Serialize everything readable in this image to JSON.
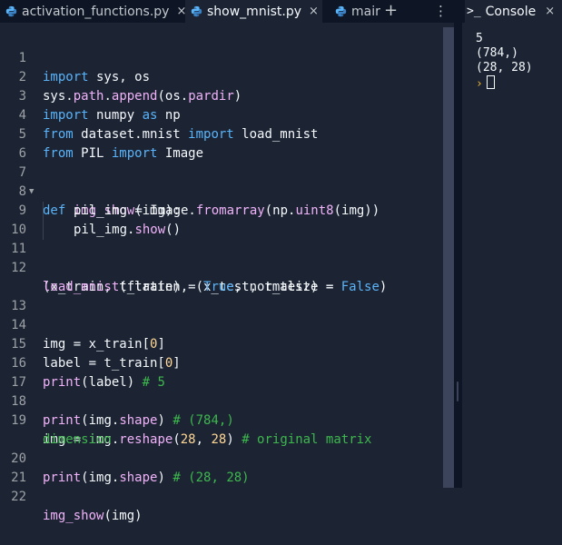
{
  "tabs": [
    {
      "label": "activation_functions.py",
      "active": false
    },
    {
      "label": "show_mnist.py",
      "active": true
    },
    {
      "label": "mair",
      "active": false
    }
  ],
  "tab_close_glyph": "×",
  "tab_add_glyph": "+",
  "tab_menu_glyph": "⋮",
  "code_lines": [
    {
      "n": "1"
    },
    {
      "n": "2"
    },
    {
      "n": "3"
    },
    {
      "n": "4"
    },
    {
      "n": "5"
    },
    {
      "n": "6"
    },
    {
      "n": "7"
    },
    {
      "n": "8"
    },
    {
      "n": "9"
    },
    {
      "n": "10"
    },
    {
      "n": "11"
    },
    {
      "n": "12"
    },
    {
      "n": "13"
    },
    {
      "n": "14"
    },
    {
      "n": "15"
    },
    {
      "n": "16"
    },
    {
      "n": "17"
    },
    {
      "n": "18"
    },
    {
      "n": "19"
    },
    {
      "n": "20"
    },
    {
      "n": "21"
    },
    {
      "n": "22"
    }
  ],
  "code": {
    "l1": [
      "import",
      " sys, os"
    ],
    "l2": [
      "sys",
      ".",
      "path",
      ".",
      "append",
      "(os.",
      "pardir",
      ")"
    ],
    "l3": [
      "import",
      " numpy ",
      "as",
      " np"
    ],
    "l4": [
      "from",
      " dataset.mnist ",
      "import",
      " load_mnist"
    ],
    "l5": [
      "from",
      " PIL ",
      "import",
      " Image"
    ],
    "l7": [
      "def",
      " ",
      "img_show",
      "(img):"
    ],
    "l8": [
      "pil_img = Image.",
      "fromarray",
      "(np.",
      "uint8",
      "(img))"
    ],
    "l9": [
      "pil_img.",
      "show",
      "()"
    ],
    "l12a": [
      "(x_train, t_train), (x_test, t_test) ="
    ],
    "l12b": [
      "load_mnist",
      "(flatten = ",
      "True",
      ", normalize = ",
      "False",
      ")"
    ],
    "l14": [
      "img = x_train[",
      "0",
      "]"
    ],
    "l15": [
      "label = t_train[",
      "0",
      "]"
    ],
    "l16": [
      "print",
      "(label) ",
      "# 5"
    ],
    "l18": [
      "print",
      "(img.",
      "shape",
      ") ",
      "# (784,)"
    ],
    "l19a": [
      "img = img.",
      "reshape",
      "(",
      "28",
      ", ",
      "28",
      ") ",
      "# original matrix"
    ],
    "l19b": [
      "dimension"
    ],
    "l20": [
      "print",
      "(img.",
      "shape",
      ") ",
      "# (28, 28)"
    ],
    "l22": [
      "img_show",
      "(img)"
    ]
  },
  "console": {
    "title": "Console",
    "prompt_icon": ">_",
    "close_glyph": "×",
    "output": [
      "5",
      "(784,)",
      "(28, 28)"
    ],
    "prompt_glyph": "›"
  },
  "colors": {
    "background": "#1c2333",
    "tabbar": "#0e1525",
    "keyword": "#5ab4f9",
    "function": "#f0b3f9",
    "number": "#ffd796",
    "comment": "#3db84d",
    "prompt": "#e9b531"
  },
  "icons": {
    "python_file": "python-icon",
    "add_tab": "plus-icon",
    "menu": "kebab-menu-icon",
    "console": "terminal-icon",
    "close": "close-icon"
  }
}
